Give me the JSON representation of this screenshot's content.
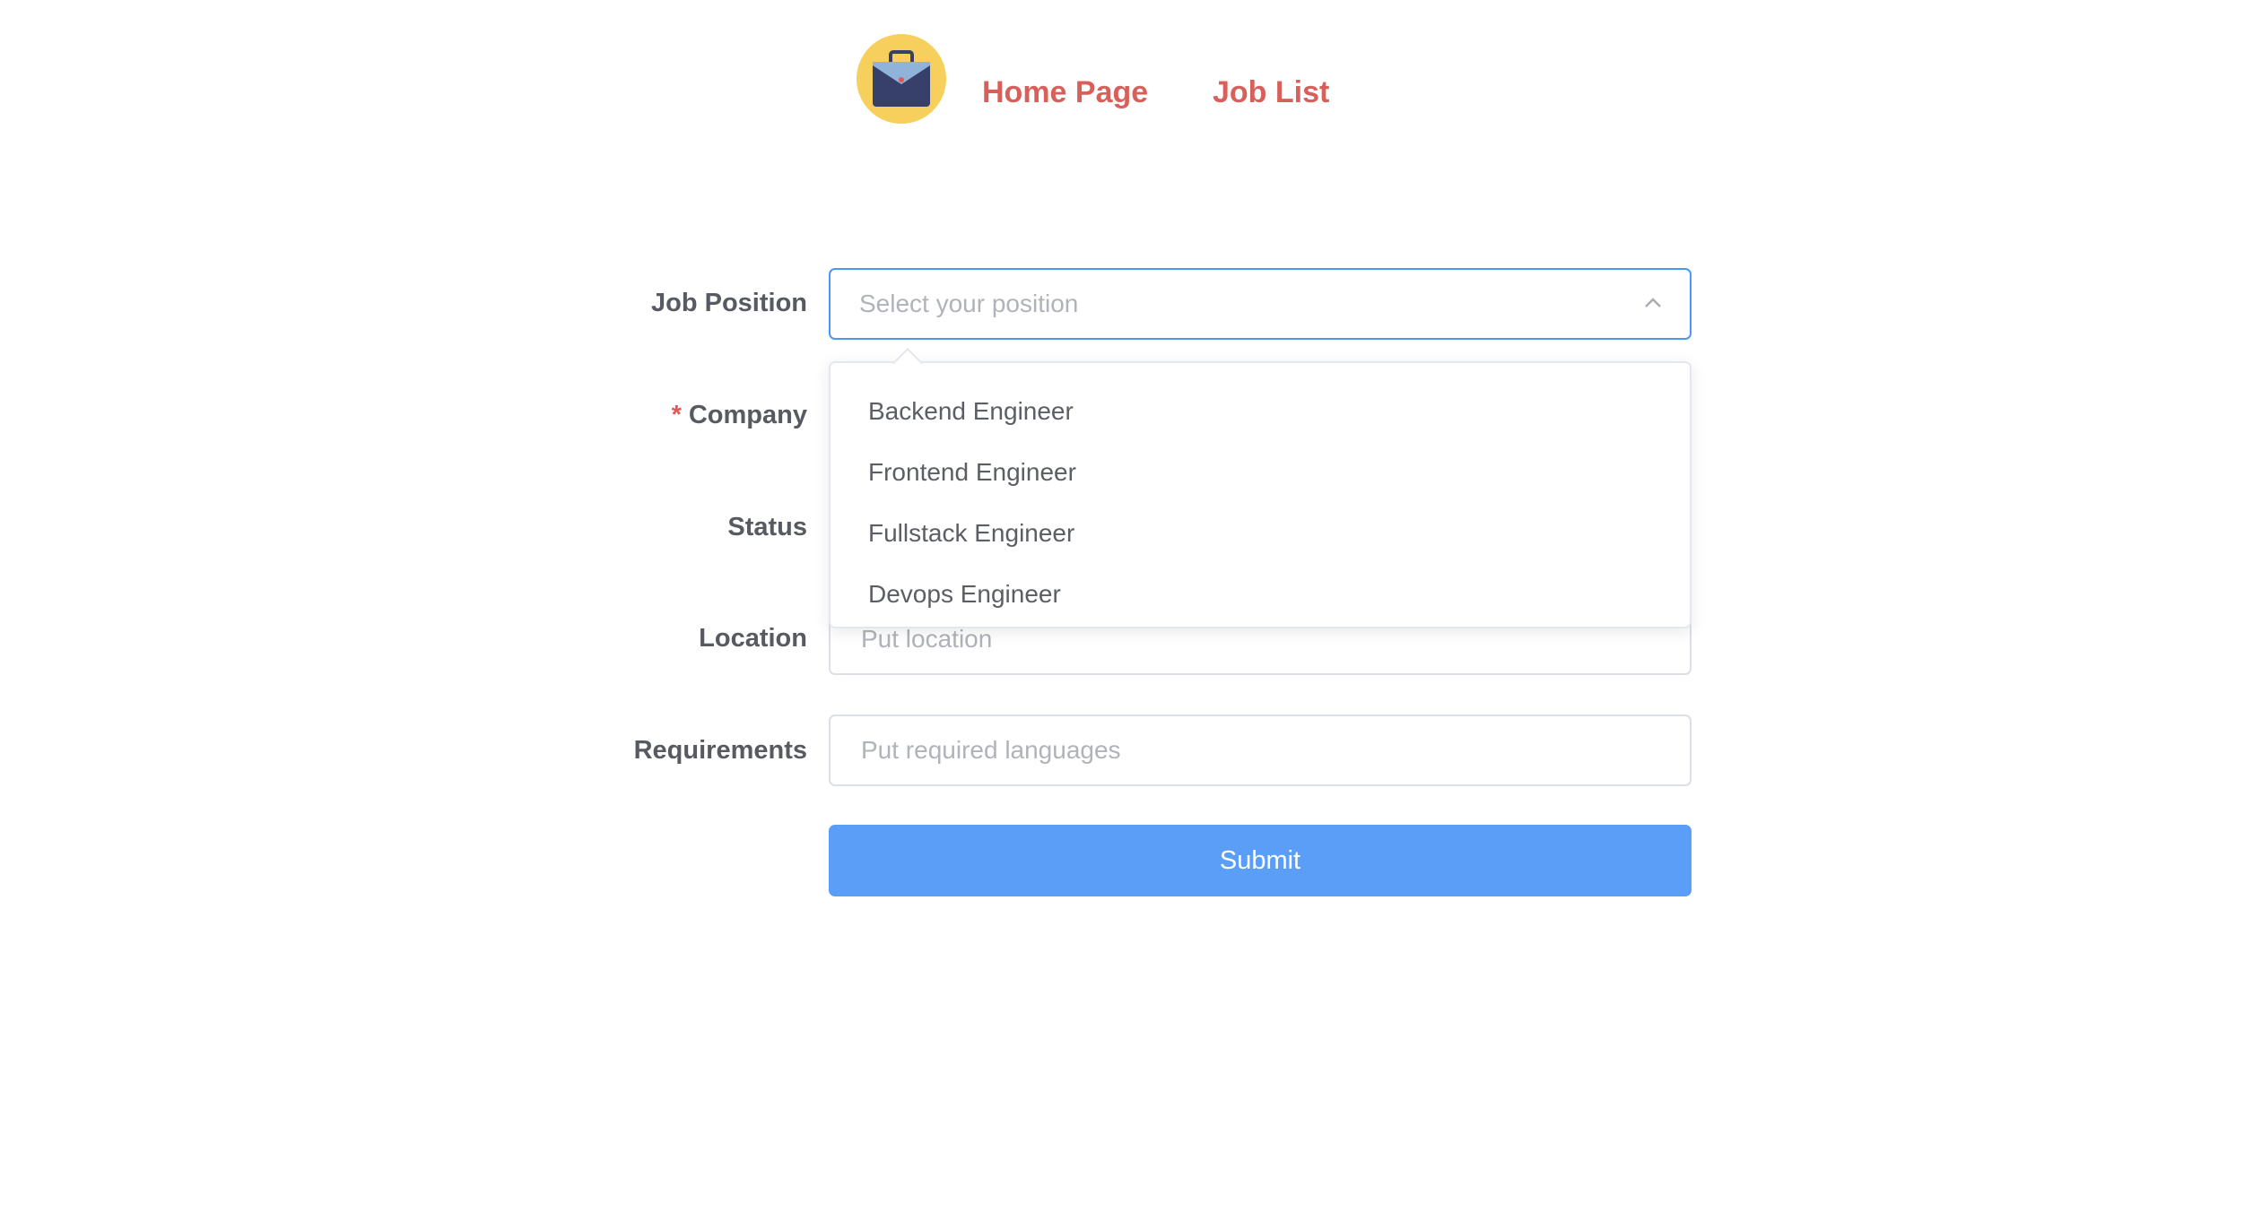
{
  "nav": {
    "logo_icon": "briefcase-icon",
    "home_label": "Home Page",
    "job_list_label": "Job List",
    "link_color": "#d9605a"
  },
  "form": {
    "job_position": {
      "label": "Job Position",
      "placeholder": "Select your position",
      "options": [
        "Backend Engineer",
        "Frontend Engineer",
        "Fullstack Engineer",
        "Devops Engineer"
      ]
    },
    "company": {
      "label": "Company",
      "required_mark": "*"
    },
    "status": {
      "label": "Status"
    },
    "location": {
      "label": "Location",
      "placeholder": "Put location"
    },
    "requirements": {
      "label": "Requirements",
      "placeholder": "Put required languages"
    },
    "submit_label": "Submit",
    "accent_color": "#5a9ef8"
  }
}
